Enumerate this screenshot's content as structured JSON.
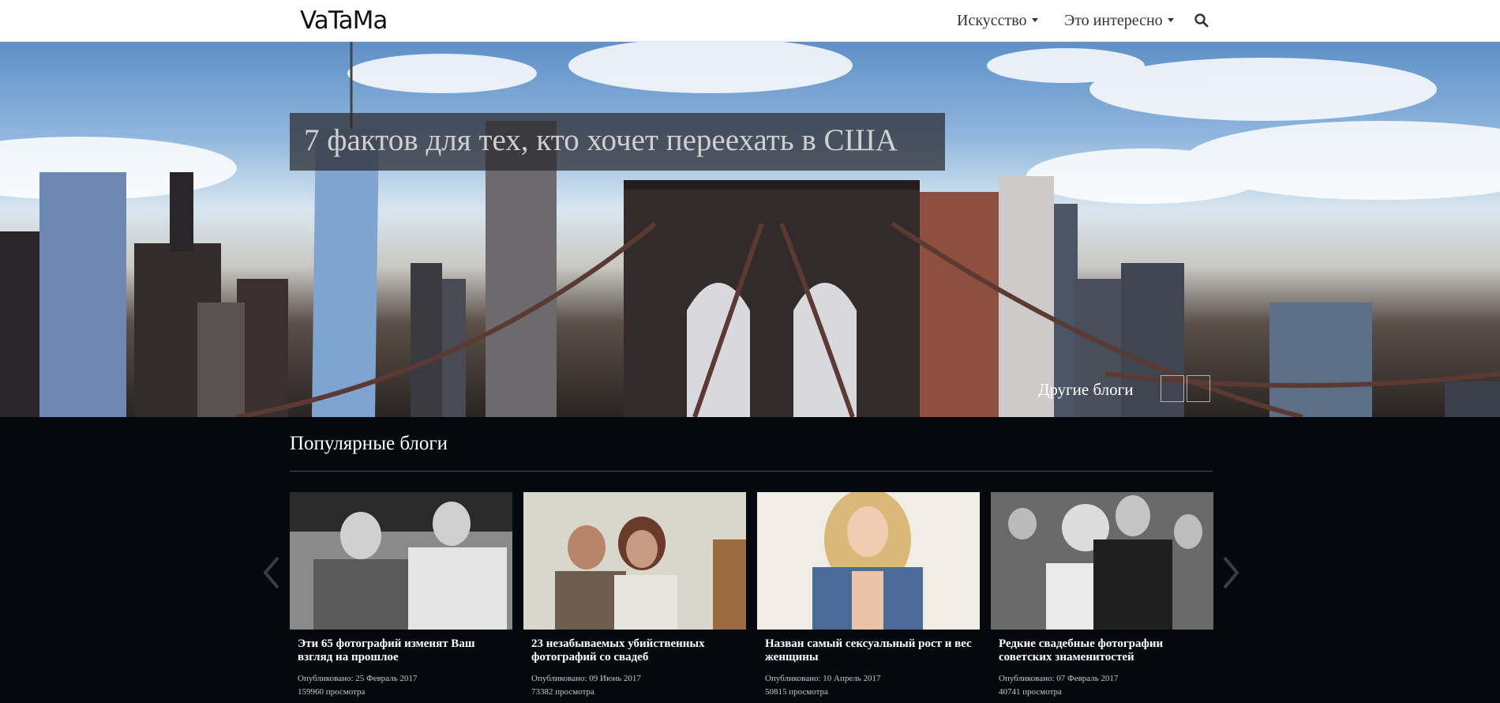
{
  "header": {
    "logo": "VaTaMa",
    "nav": [
      {
        "label": "Искусство"
      },
      {
        "label": "Это интересно"
      }
    ],
    "search_icon": "search-icon"
  },
  "hero": {
    "title": "7 фактов для тех, кто хочет переехать в США",
    "other_blogs": "Другие блоги"
  },
  "popular": {
    "title": "Популярные блоги",
    "cards": [
      {
        "title": "Эти 65 фотографий изменят Ваш взгляд на прошлое",
        "published": "Опубликовано: 25 Февраль 2017",
        "views": "159960 просмотра"
      },
      {
        "title": "23 незабываемых убийственных фотографий со свадеб",
        "published": "Опубликовано: 09 Июнь 2017",
        "views": "73382 просмотра"
      },
      {
        "title": "Назван самый сексуальный рост и вес женщины",
        "published": "Опубликовано: 10 Апрель 2017",
        "views": "50815 просмотра"
      },
      {
        "title": "Редкие свадебные фотографии советских знаменитостей",
        "published": "Опубликовано: 07 Февраль 2017",
        "views": "40741 просмотра"
      }
    ]
  },
  "colors": {
    "background": "#05080f",
    "header_bg": "#ffffff",
    "hero_title_box": "#28282d"
  }
}
